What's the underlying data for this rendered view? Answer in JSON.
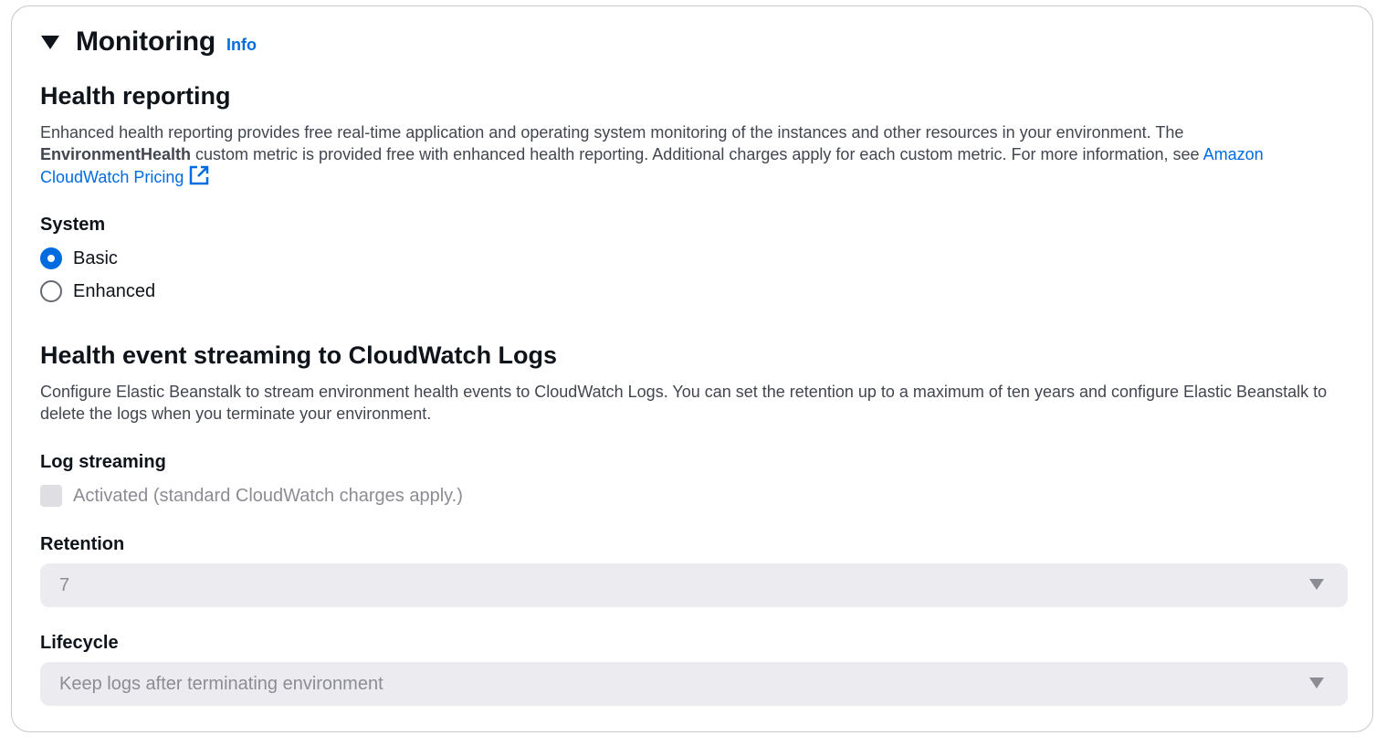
{
  "monitoring": {
    "title": "Monitoring",
    "info_label": "Info"
  },
  "health_reporting": {
    "heading": "Health reporting",
    "desc_part1": "Enhanced health reporting provides free real-time application and operating system monitoring of the instances and other resources in your environment. The ",
    "desc_bold": "EnvironmentHealth",
    "desc_part2": " custom metric is provided free with enhanced health reporting. Additional charges apply for each custom metric. For more information, see ",
    "desc_link": "Amazon CloudWatch Pricing",
    "system_label": "System",
    "options": [
      {
        "label": "Basic",
        "selected": true
      },
      {
        "label": "Enhanced",
        "selected": false
      }
    ]
  },
  "event_streaming": {
    "heading": "Health event streaming to CloudWatch Logs",
    "desc": "Configure Elastic Beanstalk to stream environment health events to CloudWatch Logs. You can set the retention up to a maximum of ten years and configure Elastic Beanstalk to delete the logs when you terminate your environment.",
    "log_streaming_label": "Log streaming",
    "activated_label": "Activated (standard CloudWatch charges apply.)",
    "activated_checked": false,
    "retention_label": "Retention",
    "retention_value": "7",
    "lifecycle_label": "Lifecycle",
    "lifecycle_value": "Keep logs after terminating environment"
  },
  "colors": {
    "accent": "#006ce0",
    "text": "#0f141a",
    "muted": "#424650",
    "disabled": "#8c8c94",
    "disabled_bg": "#ebebf0"
  }
}
